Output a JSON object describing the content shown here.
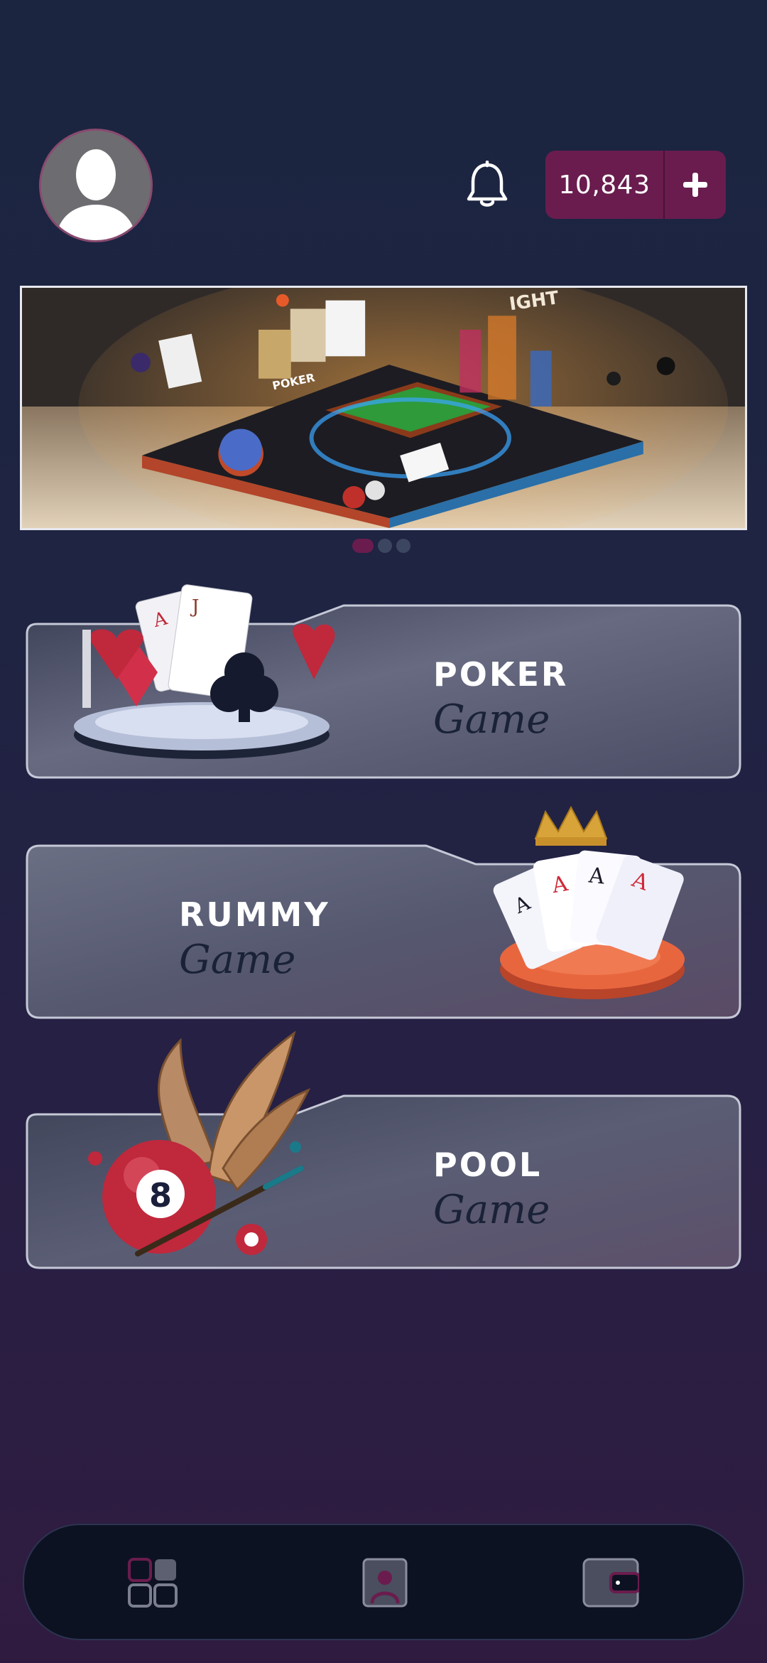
{
  "header": {
    "avatar_icon": "user-silhouette",
    "notification_icon": "bell-icon",
    "wallet": {
      "balance": "10,843",
      "add_icon": "plus-icon"
    }
  },
  "banner": {
    "slide_count": 3,
    "active_slide": 1,
    "visible_text": [
      "POKER",
      "IGHT"
    ]
  },
  "games": [
    {
      "title": "POKER",
      "subtitle": "Game",
      "icon": "poker-cards-chip-art"
    },
    {
      "title": "RUMMY",
      "subtitle": "Game",
      "icon": "crowned-aces-chip-art"
    },
    {
      "title": "POOL",
      "subtitle": "Game",
      "icon": "winged-eight-ball-art"
    }
  ],
  "bottom_nav": {
    "items": [
      {
        "id": "home",
        "icon": "grid-icon",
        "active": true
      },
      {
        "id": "profile",
        "icon": "profile-icon",
        "active": false
      },
      {
        "id": "wallet",
        "icon": "wallet-icon",
        "active": false
      }
    ]
  },
  "colors": {
    "accent": "#6a1c4e",
    "background_top": "#1b2540",
    "background_bottom": "#301b40",
    "card_surface": "#575a73",
    "nav_background": "#0d1222"
  }
}
